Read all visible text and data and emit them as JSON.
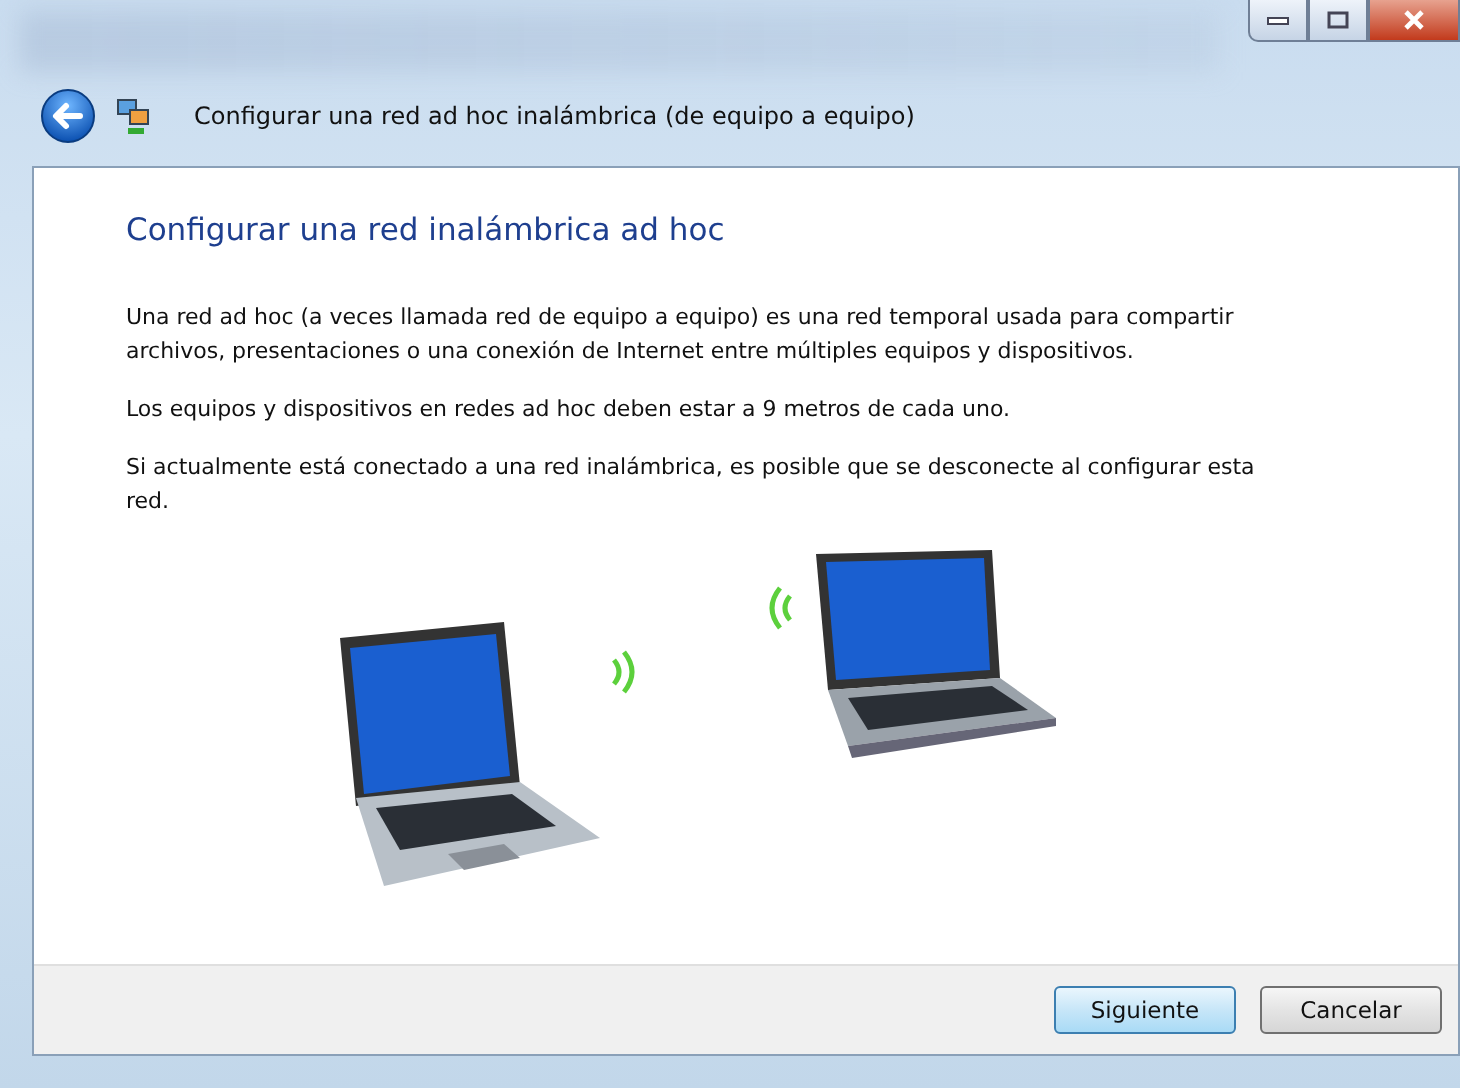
{
  "window": {
    "title": "Configurar una red ad hoc inalámbrica (de equipo a equipo)"
  },
  "page": {
    "heading": "Configurar una red inalámbrica ad hoc",
    "paragraphs": [
      "Una red ad hoc (a veces llamada red de equipo a equipo) es una red temporal usada para compartir archivos, presentaciones o una conexión de Internet entre múltiples equipos y dispositivos.",
      "Los equipos y dispositivos en redes ad hoc deben estar a 9 metros de cada uno.",
      "Si actualmente está conectado a una red inalámbrica, es posible que se desconecte al configurar esta red."
    ]
  },
  "buttons": [
    {
      "label": "Siguiente",
      "focused": true
    },
    {
      "label": "Cancelar",
      "focused": false
    }
  ]
}
